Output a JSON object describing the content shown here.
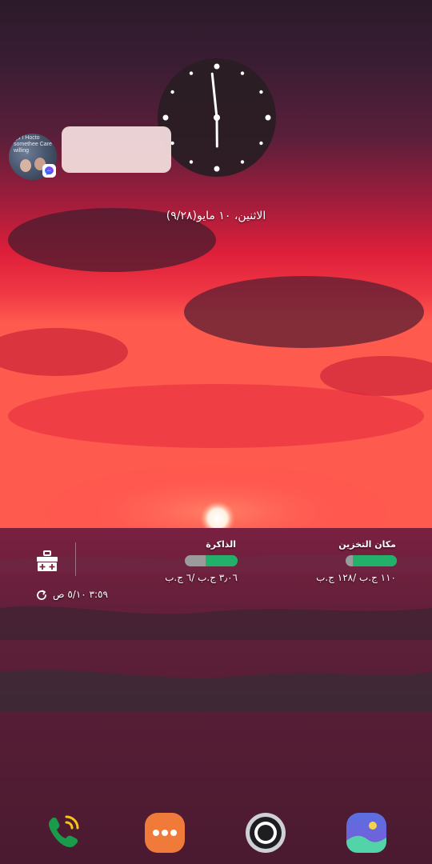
{
  "clock": {
    "hour": 5,
    "minute": 59
  },
  "date_text": "الاثنين، ١٠ مايو(٩/٢٨)",
  "conversation_widget": {
    "avatar_caption": "ا ذوأ Hocto somethee Care willing",
    "app_badge": "messenger-icon"
  },
  "device_care": {
    "storage": {
      "label": "مكان التخزين",
      "value": "١١٠ ج.ب /١٢٨ ج.ب",
      "fill": 0.86
    },
    "memory": {
      "label": "الذاكرة",
      "value": "٣٫٠٦ ج.ب /٦ ج.ب",
      "fill": 0.6
    },
    "last_refresh": "٣:٥٩ ٥/١٠ ص"
  },
  "dock": {
    "apps": [
      {
        "name": "phone",
        "icon": "phone-icon",
        "color": "#1a9a4a"
      },
      {
        "name": "messages",
        "icon": "messages-icon",
        "color": "#f07a3a"
      },
      {
        "name": "camera",
        "icon": "camera-icon",
        "color": "#2a2a2a"
      },
      {
        "name": "gallery",
        "icon": "gallery-icon",
        "color": "#4b7bd8"
      }
    ]
  },
  "colors": {
    "accent_green": "#22b06a",
    "sky_red": "#e8233a",
    "sea": "#5b1f35"
  }
}
